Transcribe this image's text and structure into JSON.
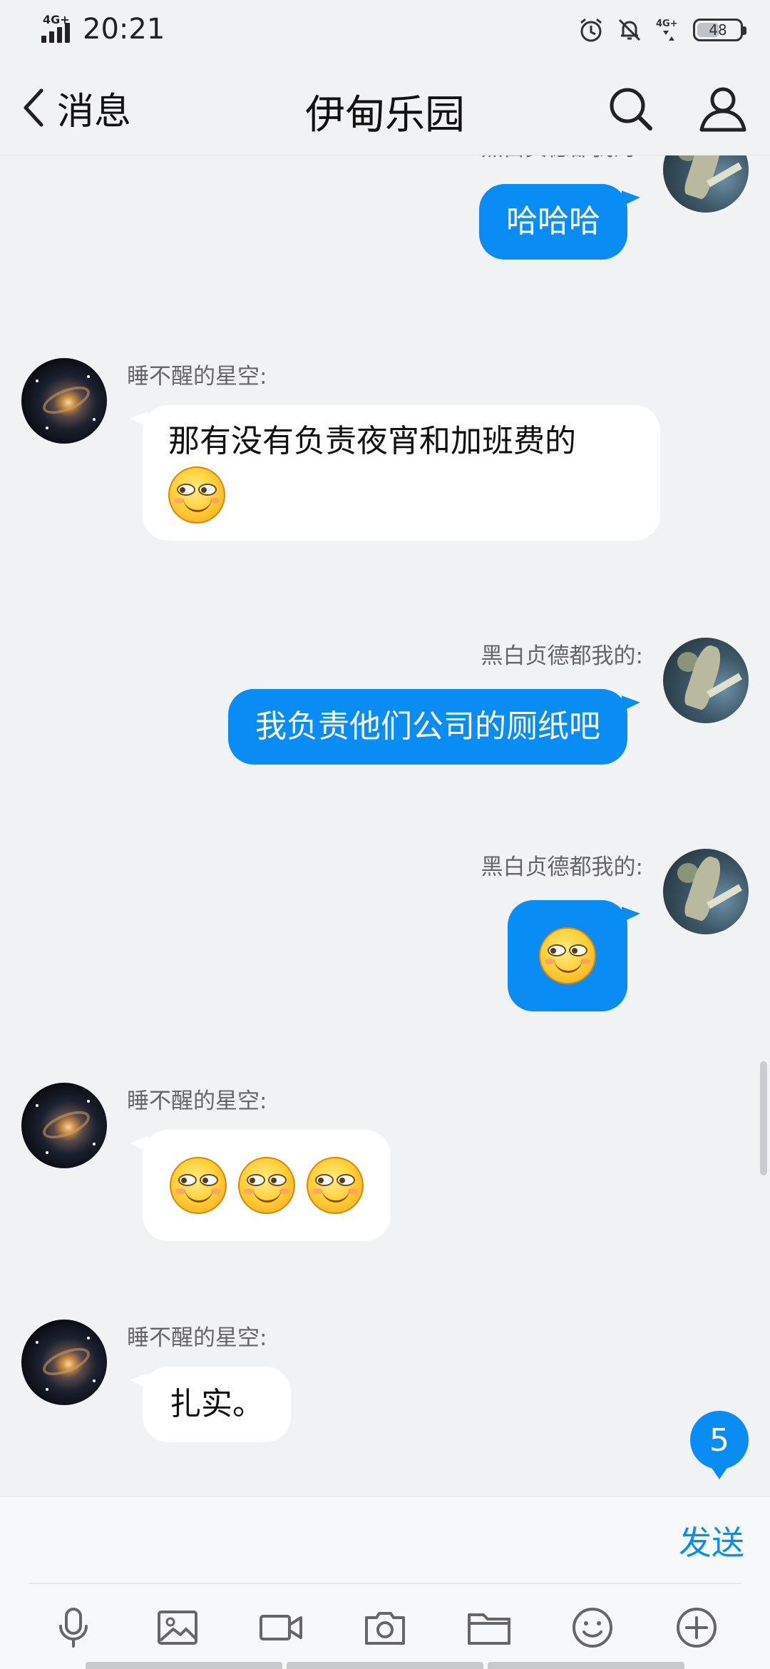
{
  "status_bar": {
    "network": "4G+",
    "time": "20:21",
    "network_right": "4G+",
    "battery": "48"
  },
  "nav": {
    "back_label": "消息",
    "title": "伊甸乐园"
  },
  "messages": [
    {
      "side": "right",
      "sender": "黑白贞德都我的:",
      "text": "哈哈哈"
    },
    {
      "side": "left",
      "sender": "睡不醒的星空:",
      "text": "那有没有负责夜宵和加班费的",
      "emoji_count": 1
    },
    {
      "side": "right",
      "sender": "黑白贞德都我的:",
      "text": "我负责他们公司的厕纸吧"
    },
    {
      "side": "right",
      "sender": "黑白贞德都我的:",
      "emoji_count": 1
    },
    {
      "side": "left",
      "sender": "睡不醒的星空:",
      "emoji_count": 3
    },
    {
      "side": "left",
      "sender": "睡不醒的星空:",
      "text": "扎实。"
    }
  ],
  "unread_count": "5",
  "input": {
    "placeholder": "",
    "send_label": "发送"
  },
  "toolbar": [
    "microphone-icon",
    "image-icon",
    "video-icon",
    "camera-icon",
    "folder-icon",
    "emoji-icon",
    "plus-icon"
  ],
  "colors": {
    "accent": "#0a8cf5",
    "background": "#f1f2f4",
    "bubble_left": "#ffffff"
  }
}
